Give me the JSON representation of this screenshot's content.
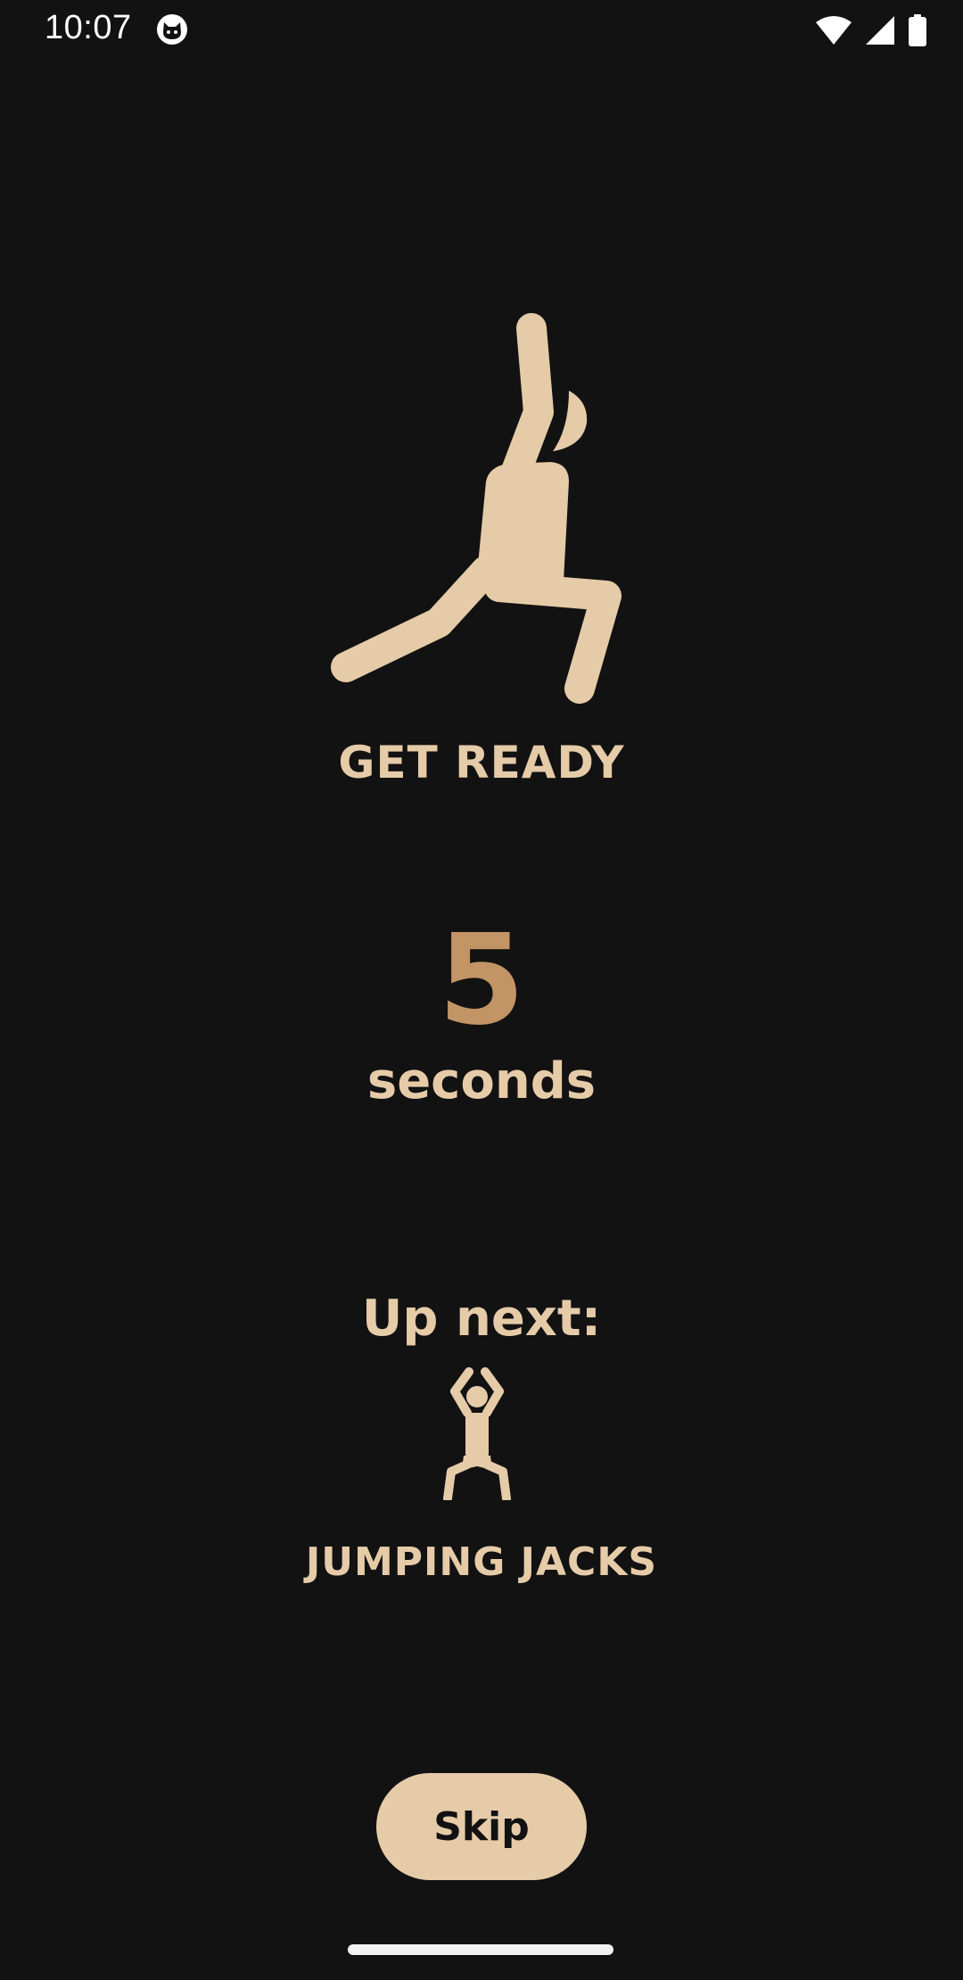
{
  "status_bar": {
    "time": "10:07",
    "icons": [
      "app-cat-icon",
      "wifi-icon",
      "cellular-signal-icon",
      "battery-icon"
    ]
  },
  "workout": {
    "status_label": "GET READY",
    "countdown_value": "5",
    "countdown_unit": "seconds",
    "up_next_label": "Up next:",
    "next_exercise_name": "JUMPING JACKS",
    "current_pose_icon": "lunge-stretch-figure-icon",
    "next_pose_icon": "jumping-jacks-figure-icon"
  },
  "actions": {
    "skip_label": "Skip"
  },
  "colors": {
    "background": "#121212",
    "accent_light": "#e6cba8",
    "accent_dark": "#c29466"
  }
}
